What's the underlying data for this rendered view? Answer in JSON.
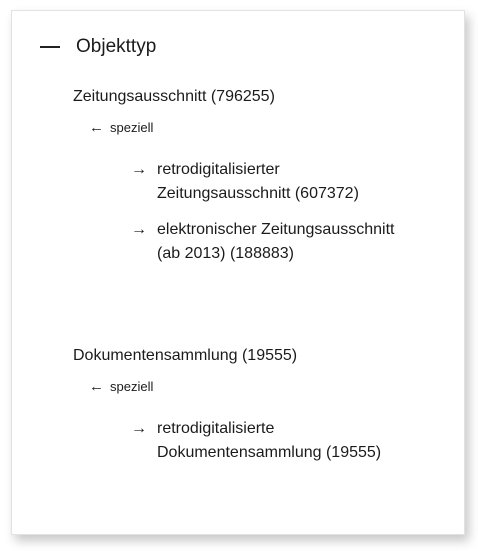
{
  "facet": {
    "title": "Objekttyp",
    "collapse_icon": "minus-icon"
  },
  "groups": [
    {
      "label": "Zeitungsausschnitt (796255)",
      "relation": {
        "arrow": "←",
        "label": "speziell"
      },
      "children": [
        {
          "arrow": "→",
          "label": "retrodigitalisierter Zeitungsausschnitt (607372)"
        },
        {
          "arrow": "→",
          "label": "elektronischer Zeitungsausschnitt (ab 2013) (188883)"
        }
      ]
    },
    {
      "label": "Dokumentensammlung (19555)",
      "relation": {
        "arrow": "←",
        "label": "speziell"
      },
      "children": [
        {
          "arrow": "→",
          "label": "retrodigitalisierte Dokumentensammlung (19555)"
        }
      ]
    }
  ]
}
